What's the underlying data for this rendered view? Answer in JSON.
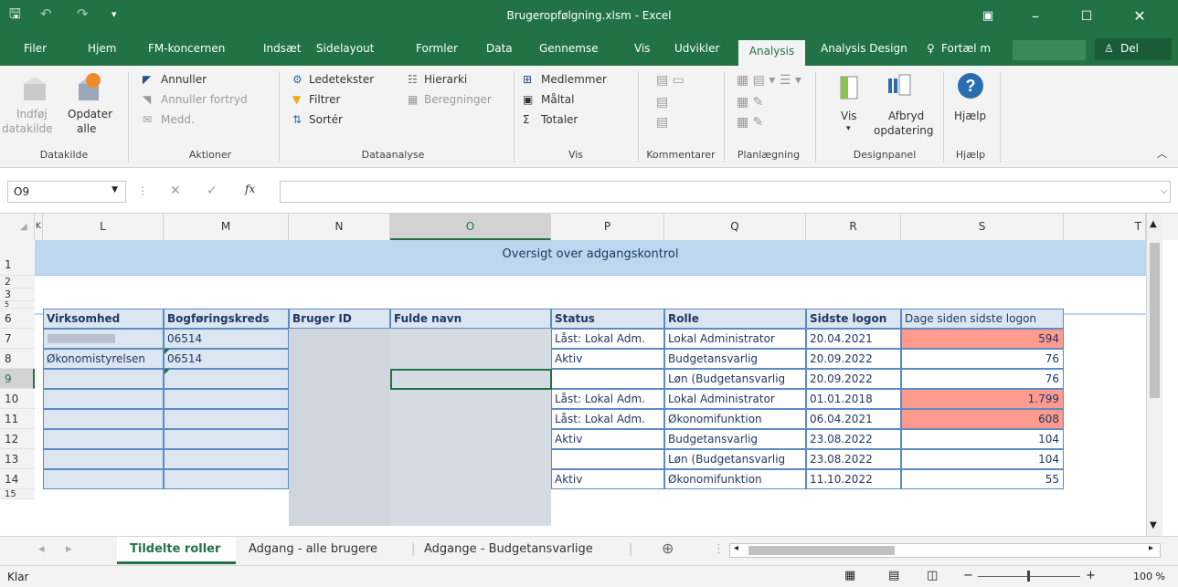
{
  "window": {
    "title": "Brugeropfølgning.xlsm - Excel"
  },
  "menu_tabs": [
    "Filer",
    "Hjem",
    "FM-koncernen",
    "Indsæt",
    "Sidelayout",
    "Formler",
    "Data",
    "Gennemse",
    "Vis",
    "Udvikler",
    "Analysis",
    "Analysis Design"
  ],
  "tell_me": "Fortæl m",
  "share": "Del",
  "ribbon": {
    "datakilde": {
      "insert": "Indføj",
      "insert2": "datakilde",
      "update": "Opdater",
      "update2": "alle",
      "label": "Datakilde"
    },
    "aktioner": {
      "undo": "Annuller",
      "redo": "Annuller fortryd",
      "msg": "Medd.",
      "label": "Aktioner"
    },
    "dataanalyse": {
      "prompts": "Ledetekster",
      "filter": "Filtrer",
      "sort": "Sortér",
      "hierarchy": "Hierarki",
      "calc": "Beregninger",
      "label": "Dataanalyse"
    },
    "vis": {
      "members": "Medlemmer",
      "measures": "Måltal",
      "totals": "Totaler",
      "label": "Vis"
    },
    "kommentarer": {
      "label": "Kommentarer"
    },
    "planlaegning": {
      "label": "Planlægning"
    },
    "designpanel": {
      "view": "Vis",
      "pause": "Afbryd",
      "pause2": "opdatering",
      "label": "Designpanel"
    },
    "hjaelp": {
      "help": "Hjælp",
      "label": "Hjælp"
    }
  },
  "formula_bar": {
    "name_box": "O9",
    "formula": ""
  },
  "columns": [
    "K",
    "L",
    "M",
    "N",
    "O",
    "P",
    "Q",
    "R",
    "S",
    "T"
  ],
  "rows": [
    "1",
    "2",
    "3",
    "5",
    "6",
    "7",
    "8",
    "9",
    "10",
    "11",
    "12",
    "13",
    "14",
    "15"
  ],
  "sheet": {
    "banner": "Oversigt over adgangskontrol",
    "headers": [
      "Virksomhed",
      "Bogføringskreds",
      "Bruger ID",
      "Fulde navn",
      "Status",
      "Rolle",
      "Sidste logon",
      "Dage siden sidste logon"
    ],
    "data": [
      {
        "virksomhed": "",
        "kreds": "06514",
        "status": "Låst: Lokal Adm.",
        "rolle": "Lokal Administrator",
        "logon": "20.04.2021",
        "dage": "594",
        "red": true
      },
      {
        "virksomhed": "Økonomistyrelsen",
        "kreds": "06514",
        "status": "Aktiv",
        "rolle": "Budgetansvarlig",
        "logon": "20.09.2022",
        "dage": "76",
        "red": false
      },
      {
        "virksomhed": "",
        "kreds": "",
        "status": "",
        "rolle": "Løn (Budgetansvarlig",
        "logon": "20.09.2022",
        "dage": "76",
        "red": false
      },
      {
        "virksomhed": "",
        "kreds": "",
        "status": "Låst: Lokal Adm.",
        "rolle": "Lokal Administrator",
        "logon": "01.01.2018",
        "dage": "1.799",
        "red": true
      },
      {
        "virksomhed": "",
        "kreds": "",
        "status": "Låst: Lokal Adm.",
        "rolle": "Økonomifunktion",
        "logon": "06.04.2021",
        "dage": "608",
        "red": true
      },
      {
        "virksomhed": "",
        "kreds": "",
        "status": "Aktiv",
        "rolle": "Budgetansvarlig",
        "logon": "23.08.2022",
        "dage": "104",
        "red": false
      },
      {
        "virksomhed": "",
        "kreds": "",
        "status": "",
        "rolle": "Løn (Budgetansvarlig",
        "logon": "23.08.2022",
        "dage": "104",
        "red": false
      },
      {
        "virksomhed": "",
        "kreds": "",
        "status": "Aktiv",
        "rolle": "Økonomifunktion",
        "logon": "11.10.2022",
        "dage": "55",
        "red": false
      }
    ]
  },
  "sheet_tabs": [
    "Tildelte roller",
    "Adgang - alle brugere",
    "Adgange - Budgetansvarlige"
  ],
  "status_bar": {
    "ready": "Klar",
    "zoom": "100 %"
  },
  "colors": {
    "excel_green": "#217346",
    "banner": "#bdd7ee",
    "header_fill": "#dce6f1",
    "red_fill": "#ff9b8e"
  }
}
